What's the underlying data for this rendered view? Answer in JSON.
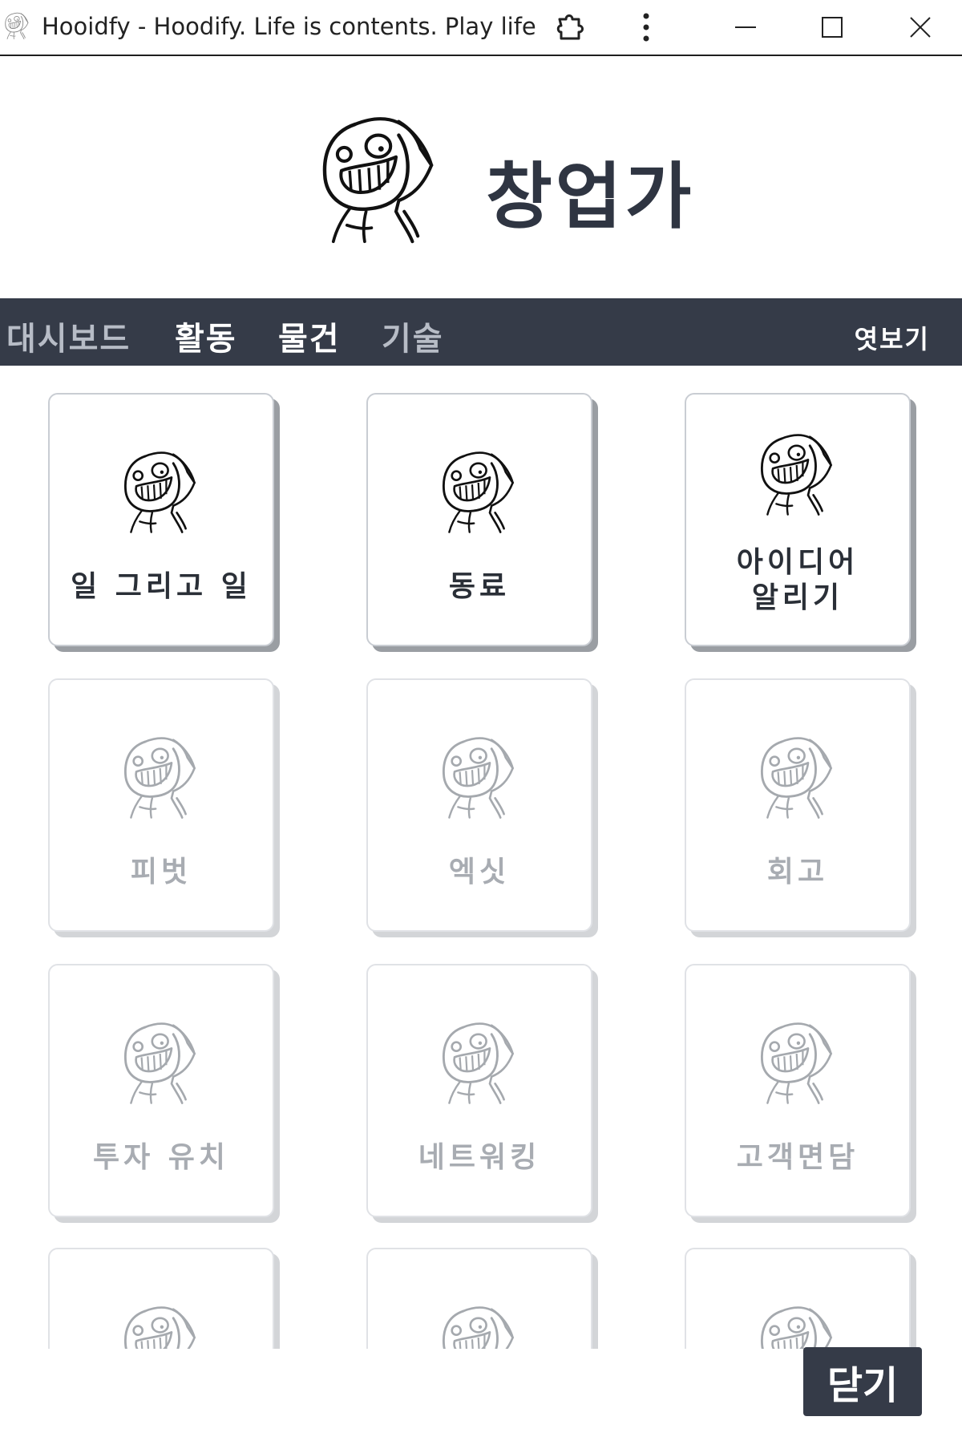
{
  "window": {
    "title": "Hooidfy - Hoodify. Life is contents. Play life",
    "icons": [
      "app-icon",
      "extension-icon",
      "more-vertical-icon",
      "minimize-icon",
      "maximize-icon",
      "close-icon"
    ]
  },
  "header": {
    "title": "창업가",
    "avatar_icon": "hooded-face-icon"
  },
  "nav": {
    "items": [
      {
        "label": "대시보드",
        "active": false
      },
      {
        "label": "활동",
        "active": true
      },
      {
        "label": "물건",
        "active": true
      },
      {
        "label": "기술",
        "active": false
      }
    ],
    "peek_label": "엿보기"
  },
  "cards": [
    {
      "label": "일 그리고 일",
      "locked": false
    },
    {
      "label": "동료",
      "locked": false
    },
    {
      "label": "아이디어\n알리기",
      "line1": "아이디어",
      "line2": "알리기",
      "locked": false
    },
    {
      "label": "피벗",
      "locked": true
    },
    {
      "label": "엑싯",
      "locked": true
    },
    {
      "label": "회고",
      "locked": true
    },
    {
      "label": "투자 유치",
      "locked": true
    },
    {
      "label": "네트워킹",
      "locked": true
    },
    {
      "label": "고객면담",
      "locked": true
    }
  ],
  "close_button": {
    "label": "닫기"
  },
  "colors": {
    "nav_bg": "#353b48",
    "title_text": "#2f3542",
    "locked_text": "#a8acb2"
  }
}
